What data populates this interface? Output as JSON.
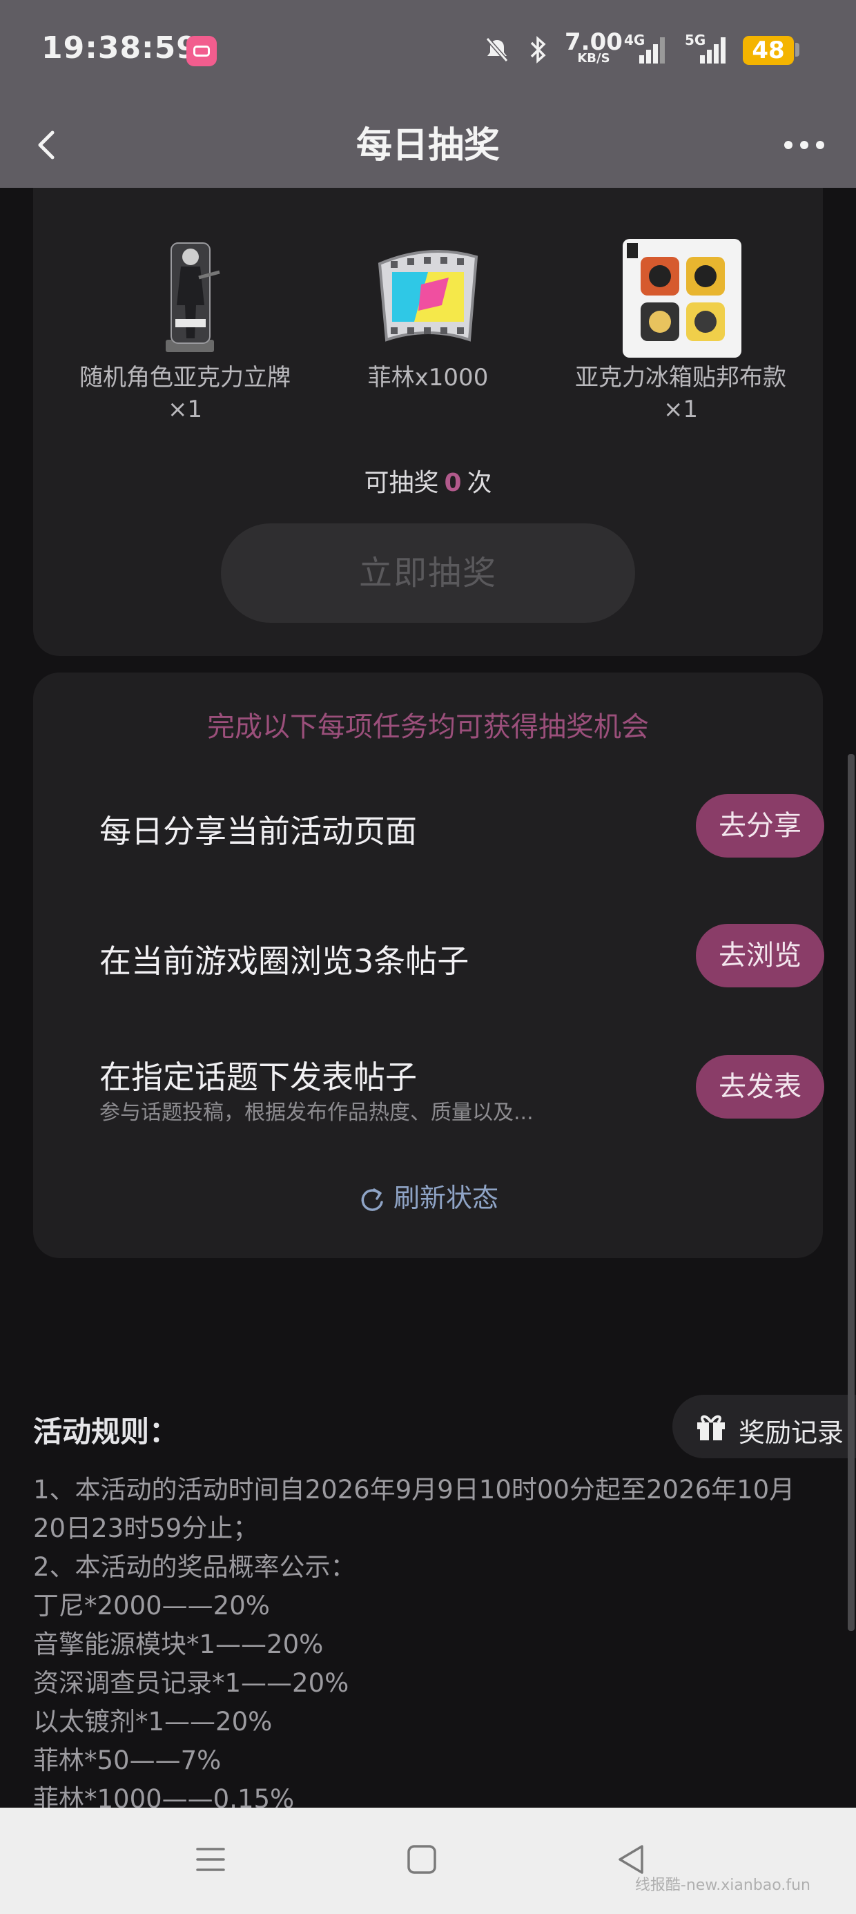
{
  "status_bar": {
    "time": "19:38:59",
    "speed_value": "7.00",
    "speed_unit": "KB/S",
    "net1": "4G",
    "net2": "5G",
    "battery": "48"
  },
  "header": {
    "title": "每日抽奖"
  },
  "prizes": [
    {
      "label": "随机角色亚克力立牌×1",
      "icon": "acrylic-stand-icon"
    },
    {
      "label": "菲林x1000",
      "icon": "film-icon"
    },
    {
      "label": "亚克力冰箱贴邦布款×1",
      "icon": "fridge-magnet-icon"
    }
  ],
  "draw": {
    "count_prefix": "可抽奖",
    "count": "0",
    "count_suffix": "次",
    "button": "立即抽奖"
  },
  "tasks": {
    "header": "完成以下每项任务均可获得抽奖机会",
    "items": [
      {
        "title": "每日分享当前活动页面",
        "button": "去分享"
      },
      {
        "title": "在当前游戏圈浏览3条帖子",
        "button": "去浏览"
      },
      {
        "title": "在指定话题下发表帖子",
        "subtitle": "参与话题投稿，根据发布作品热度、质量以及...",
        "button": "去发表"
      }
    ],
    "refresh": "刷新状态"
  },
  "reward_record": "奖励记录",
  "rules": {
    "title": "活动规则：",
    "lines": [
      "1、本活动的活动时间自2026年9月9日10时00分起至2026年10月20日23时59分止；",
      "2、本活动的奖品概率公示：",
      "丁尼*2000——20%",
      "音擎能源模块*1——20%",
      "资深调查员记录*1——20%",
      "以太镀剂*1——20%",
      "菲林*50——7%",
      "菲林*1000——0.15%"
    ]
  },
  "watermark": "线报酷-new.xianbao.fun",
  "colors": {
    "accent": "#8a3d68",
    "accent_text": "#9b4f7b",
    "card_bg": "#201f21",
    "page_bg": "#131214"
  }
}
